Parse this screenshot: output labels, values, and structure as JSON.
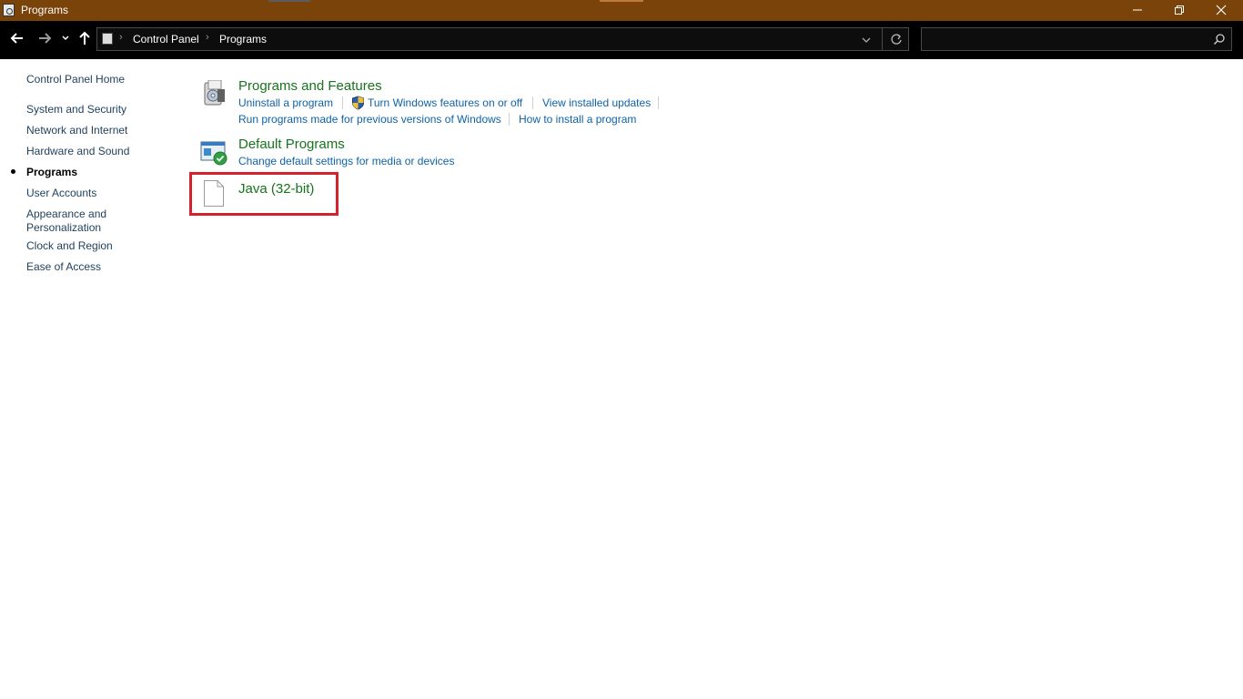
{
  "window": {
    "title": "Programs"
  },
  "navigation": {
    "breadcrumb": [
      "Control Panel",
      "Programs"
    ],
    "search_placeholder": ""
  },
  "sidebar": {
    "items": [
      {
        "label": "Control Panel Home",
        "current": false
      },
      {
        "label": "System and Security",
        "current": false
      },
      {
        "label": "Network and Internet",
        "current": false
      },
      {
        "label": "Hardware and Sound",
        "current": false
      },
      {
        "label": "Programs",
        "current": true
      },
      {
        "label": "User Accounts",
        "current": false
      },
      {
        "label": "Appearance and",
        "current": false
      },
      {
        "label": "Personalization",
        "current": false
      },
      {
        "label": "Clock and Region",
        "current": false
      },
      {
        "label": "Ease of Access",
        "current": false
      }
    ]
  },
  "categories": {
    "programs_features": {
      "title": "Programs and Features",
      "links": [
        "Uninstall a program",
        "Turn Windows features on or off",
        "View installed updates",
        "Run programs made for previous versions of Windows",
        "How to install a program"
      ]
    },
    "default_programs": {
      "title": "Default Programs",
      "links": [
        "Change default settings for media or devices"
      ]
    },
    "java": {
      "title": "Java (32-bit)"
    }
  },
  "colors": {
    "titlebar": "#7a4309",
    "navbar": "#000000",
    "category_title": "#16741c",
    "link": "#0e62a8",
    "highlight": "#d6202e"
  }
}
